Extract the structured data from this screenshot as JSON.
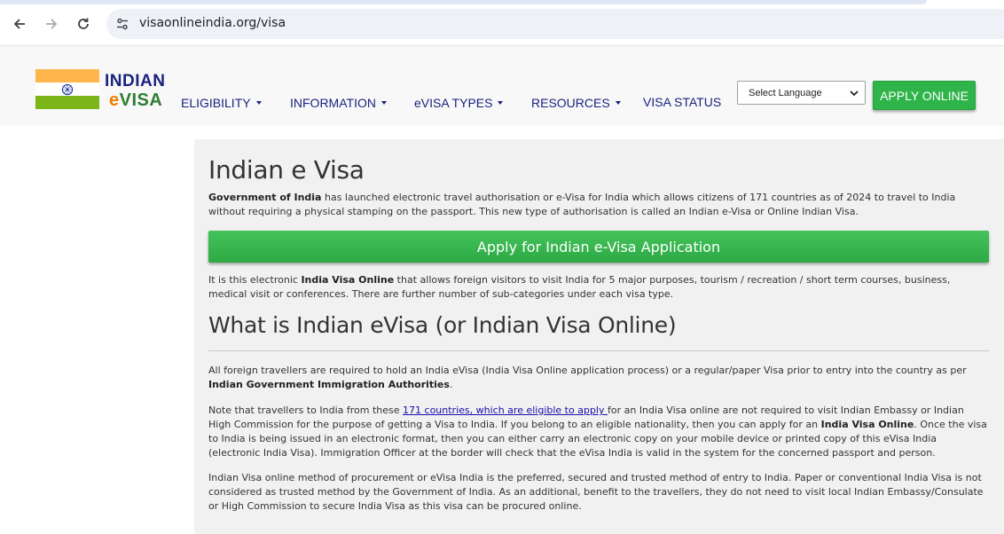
{
  "browser": {
    "url": "visaonlineindia.org/visa"
  },
  "header": {
    "logo_line1": "INDIAN",
    "logo_e": "e",
    "logo_visa": "VISA",
    "menu": [
      {
        "label": "ELIGIBILITY",
        "dropdown": true
      },
      {
        "label": "INFORMATION",
        "dropdown": true
      },
      {
        "label": "eVISA TYPES",
        "dropdown": true
      },
      {
        "label": "RESOURCES",
        "dropdown": true
      },
      {
        "label": "VISA STATUS",
        "dropdown": false
      }
    ],
    "language_select": "Select Language",
    "apply_online": "APPLY ONLINE"
  },
  "colors": {
    "flag_saffron": "#FFB74D",
    "flag_white": "#FFFFFF",
    "flag_green": "#7CB518",
    "brand_navy": "#1A237E",
    "brand_green": "#2E7D32",
    "button_green": "#2FB44A"
  },
  "main": {
    "title": "Indian e Visa",
    "intro_bold": "Government of India",
    "intro_rest": " has launched electronic travel authorisation or e-Visa for India which allows citizens of 171 countries as of 2024 to travel to India without requiring a physical stamping on the passport. This new type of authorisation is called an Indian e-Visa or Online Indian Visa.",
    "apply_button": "Apply for Indian e-Visa Application",
    "p2_start": "It is this electronic ",
    "p2_bold": "India Visa Online",
    "p2_end": " that allows foreign visitors to visit India for 5 major purposes, tourism / recreation / short term courses, business, medical visit or conferences. There are further number of sub-categories under each visa type.",
    "heading2": "What is Indian eVisa (or Indian Visa Online)",
    "p3_start": "All foreign travellers are required to hold an India eVisa (India Visa Online application process) or a regular/paper Visa prior to entry into the country as per ",
    "p3_bold": "Indian Government Immigration Authorities",
    "p3_end": ".",
    "p4_start": "Note that travellers to India from these ",
    "p4_link": "171 countries, which are eligible to apply ",
    "p4_mid": "for an India Visa online are not required to visit Indian Embassy or Indian High Commission for the purpose of getting a Visa to India. If you belong to an eligible nationality, then you can apply for an ",
    "p4_bold": "India Visa Online",
    "p4_end": ". Once the visa to India is being issued in an electronic format, then you can either carry an electronic copy on your mobile device or printed copy of this eVisa India (electronic India Visa). Immigration Officer at the border will check that the eVisa India is valid in the system for the concerned passport and person.",
    "p5": "Indian Visa online method of procurement or eVisa India is the preferred, secured and trusted method of entry to India. Paper or conventional India Visa is not considered as trusted method by the Government of India. As an additional, benefit to the travellers, they do not need to visit local Indian Embassy/Consulate or High Commission to secure India Visa as this visa can be procured online."
  }
}
